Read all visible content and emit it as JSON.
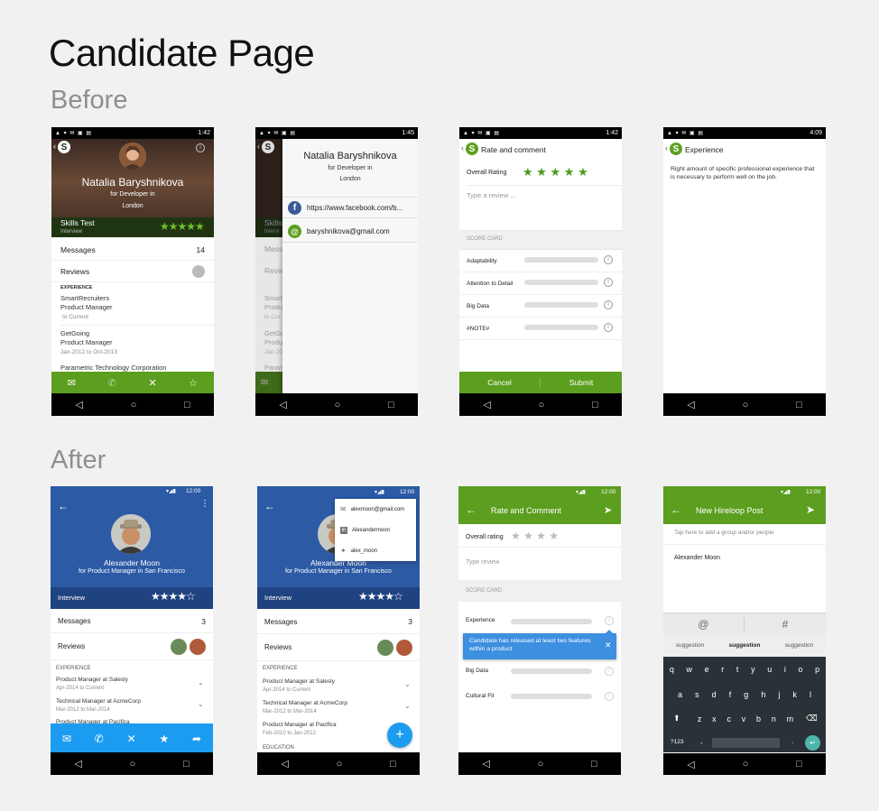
{
  "page": {
    "title": "Candidate Page",
    "before_label": "Before",
    "after_label": "After"
  },
  "before": {
    "p1": {
      "time": "1:42",
      "name": "Natalia Baryshnikova",
      "role": "for Developer in",
      "city": "London",
      "skills": "Skills Test",
      "skills_sub": "Interview",
      "stars": "★★★★★",
      "messages": "Messages",
      "messages_count": "14",
      "reviews": "Reviews",
      "exp_header": "EXPERIENCE",
      "exp1_company": "SmartRecruiters",
      "exp1_title": "Product Manager",
      "exp1_dates": "to Current",
      "exp2_company": "GetGoing",
      "exp2_title": "Product Manager",
      "exp2_dates": "Jan-2012 to Oct-2013",
      "exp3_company": "Parametric Technology Corporation"
    },
    "p2": {
      "time": "1:45",
      "name": "Natalia Baryshnikova",
      "role": "for Developer in",
      "city": "London",
      "facebook": "https://www.facebook.com/b...",
      "email": "baryshnikova@gmail.com",
      "bg_skills": "Skills",
      "bg_interview": "Intervi",
      "bg_messages": "Messa",
      "bg_reviews": "Revie",
      "bg_exp_a": "Smart",
      "bg_exp_b": "Produc",
      "bg_exp_c": "to Cur",
      "bg_exp_d": "GetGo",
      "bg_exp_e": "Produc",
      "bg_exp_f": "Jan-20",
      "bg_exp_g": "Param"
    },
    "p3": {
      "time": "1:42",
      "title": "Rate and comment",
      "overall": "Overall Rating",
      "stars": "★ ★ ★ ★ ★",
      "placeholder": "Type a review ...",
      "score_card": "SCORE CARD",
      "items": [
        "Adaptability",
        "Attention to Detail",
        "Big Data",
        "#NOTE#"
      ],
      "cancel": "Cancel",
      "submit": "Submit"
    },
    "p4": {
      "time": "4:09",
      "title": "Experience",
      "desc": "Right amount of specific professional experience that is necessary to perform well on the job."
    }
  },
  "after": {
    "p1": {
      "time": "12:00",
      "name": "Alexander Moon",
      "role": "for  Product Manager in San Francisco",
      "interview": "Interview",
      "stars": "★★★★☆",
      "messages": "Messages",
      "messages_count": "3",
      "reviews": "Reviews",
      "exp_header": "EXPERIENCE",
      "exp1": "Product Manager at Salesly",
      "exp1_dates": "Apr-2014 to Current",
      "exp2": "Technical Manager at AcmeCorp",
      "exp2_dates": "Mar-2012 to Mar-2014",
      "exp3": "Product Manager at Pacifica"
    },
    "p2": {
      "time": "12:00",
      "name": "Alexander Moon",
      "role": "for  Product Manager in San Francisco",
      "menu": [
        "alexmoon@gmail.com",
        "Alexandermoon",
        "alex_moon"
      ],
      "interview": "Interview",
      "stars": "★★★★☆",
      "messages": "Messages",
      "messages_count": "3",
      "reviews": "Reviews",
      "exp_header": "EXPERIENCE",
      "exp1": "Product Manager at Salesly",
      "exp1_dates": "Apr-2014 to Current",
      "exp2": "Technical Manager at AcmeCorp",
      "exp2_dates": "Mar-2012 to Mar-2014",
      "exp3": "Product Manager at Pacifica",
      "exp3_dates": "Feb-2010 to Jan-2012",
      "edu_header": "EDUCATION",
      "fab": "+"
    },
    "p3": {
      "time": "12:00",
      "title": "Rate and Comment",
      "overall": "Overall rating",
      "stars": "★  ★  ★  ★",
      "placeholder": "Type review",
      "score_card": "SCORE CARD",
      "experience": "Experience",
      "tooltip": "Candidate has released at least two features within a product",
      "big_data": "Big Data",
      "culture": "Cultural Fit"
    },
    "p4": {
      "time": "12:00",
      "title": "New Hireloop Post",
      "placeholder": "Tap here to add a group and/or people",
      "mention": "Alexander Moon",
      "at": "@",
      "hash": "#",
      "suggestions": [
        "suggestion",
        "suggestion",
        "suggestion"
      ],
      "row1": [
        "q",
        "w",
        "e",
        "r",
        "t",
        "y",
        "u",
        "i",
        "o",
        "p"
      ],
      "row2": [
        "a",
        "s",
        "d",
        "f",
        "g",
        "h",
        "j",
        "k",
        "l"
      ],
      "row3": [
        "z",
        "x",
        "c",
        "v",
        "b",
        "n",
        "m"
      ],
      "sym": "?123",
      "comma": ",",
      "dot": "."
    }
  },
  "colors": {
    "green": "#5c9e1f",
    "blue": "#2c5aa5",
    "light_blue": "#1c9cf0",
    "tooltip": "#3d8fe0"
  }
}
